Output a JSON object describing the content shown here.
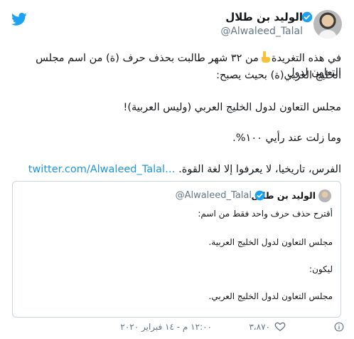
{
  "author": {
    "name": "الوليد بن طلال",
    "handle": "@Alwaleed_Talal"
  },
  "tweet": {
    "line1_before": "في هذه التغريدة",
    "line1_after": "من ٣٢ شهر طالبت بحذف حرف (ة) من اسم مجلس التعاون لدول",
    "line2": "الخليج العربي(ة) بحيث يصبح:",
    "line3": "مجلس التعاون لدول الخليج العربي (وليس العربية)!",
    "line4": "وما زلت عند رأيي ١٠٠%.",
    "line5": "الفرس، تاريخيا، لا يعرفوا إلا لغة القوة.",
    "link": "twitter.com/Alwaleed_Talal…"
  },
  "quoted_tweet": {
    "name": "الوليد بن طلال",
    "handle": "@Alwaleed_Talal",
    "lines": [
      "أقترح حذف حرف واحد فقط من اسم:",
      "مجلس التعاون لدول الخليج العربية.",
      "ليكون:",
      "مجلس التعاون لدول الخليج العربي."
    ]
  },
  "footer": {
    "timestamp": "١٢:٠٠ م - ١٤ فبراير ٢٠٢٠",
    "likes": "٣،٨٧٠"
  },
  "colors": {
    "twitter_blue": "#1da1f2",
    "link": "#1b95e0",
    "secondary_text": "#657786",
    "border": "#ccd6dd"
  },
  "icons": {
    "brand": "twitter-bird-icon",
    "verified": "verified-badge-icon",
    "emoji": "pointing-down-hand-emoji",
    "like": "heart-icon",
    "info": "info-icon"
  }
}
